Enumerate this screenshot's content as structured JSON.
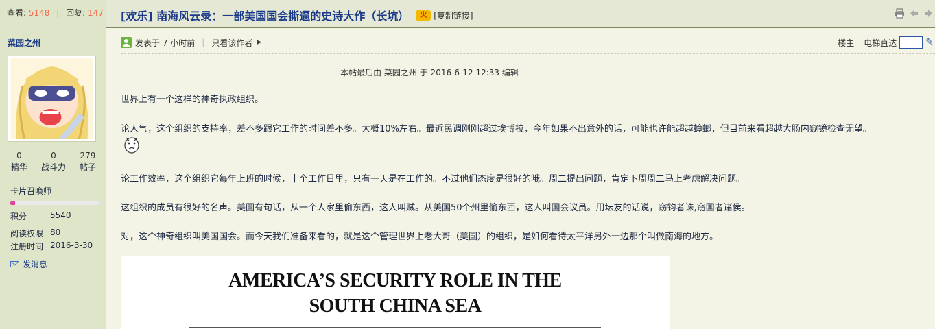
{
  "header": {
    "views_label": "查看:",
    "views_value": "5148",
    "replies_label": "回复:",
    "replies_value": "147",
    "title": "[欢乐] 南海风云录：一部美国国会撕逼的史诗大作（长坑）",
    "hot_badge": "火",
    "copy_link": "[复制链接]",
    "icons": [
      "print-icon",
      "prev-thread-icon",
      "next-thread-icon"
    ]
  },
  "sidebar": {
    "username": "菜园之州",
    "stats": [
      {
        "value": "0",
        "label": "精华"
      },
      {
        "value": "0",
        "label": "战斗力"
      },
      {
        "value": "279",
        "label": "帖子"
      }
    ],
    "rank": "卡片召唤师",
    "progress_fraction": 0.05,
    "points_label": "积分",
    "points_value": "5540",
    "read_perm_label": "阅读权限",
    "read_perm_value": "80",
    "reg_label": "注册时间",
    "reg_value": "2016-3-30",
    "message_label": "发消息"
  },
  "post": {
    "posted": "发表于 7 小时前",
    "only_author": "只看该作者",
    "floor_owner": "楼主",
    "elevator": "电梯直达",
    "edit_note": "本帖最后由 菜园之州 于 2016-6-12 12:33 编辑",
    "paragraphs": [
      "世界上有一个这样的神奇执政组织。",
      "论人气，这个组织的支持率，差不多跟它工作的时间差不多。大概10%左右。最近民调刚刚超过埃博拉，今年如果不出意外的话，可能也许能超越蟑螂，但目前来看超越大肠内窥镜检查无望。",
      "论工作效率，这个组织它每年上班的时候，十个工作日里，只有一天是在工作的。不过他们态度是很好的哦。周二提出问题，肯定下周周二马上考虑解决问题。",
      "这组织的成员有很好的名声。美国有句话，从一个人家里偷东西，这人叫贼。从美国50个州里偷东西，这人叫国会议员。用坛友的话说，窃钩者诛,窃国者诸侯。",
      "对，这个神奇组织叫美国国会。而今天我们准备来看的，就是这个管理世界上老大哥（美国）的组织，是如何看待太平洋另外一边那个叫做南海的地方。"
    ],
    "image_title_line1": "AMERICA’S SECURITY ROLE IN THE",
    "image_title_line2": "SOUTH CHINA SEA"
  }
}
